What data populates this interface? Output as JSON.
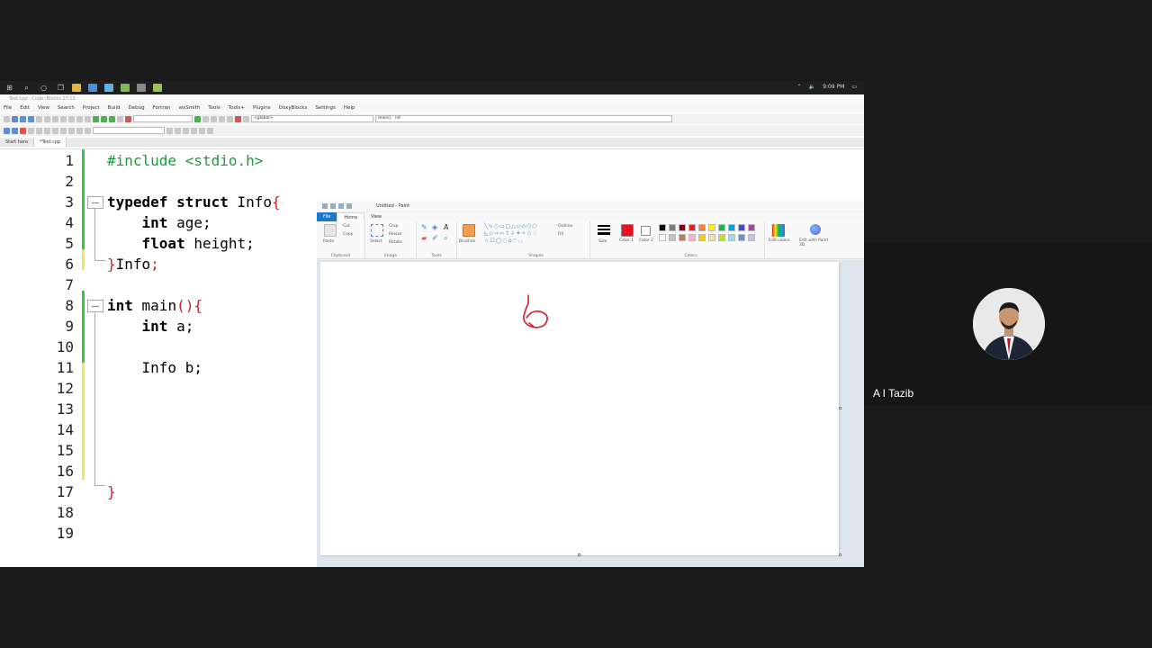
{
  "taskbar": {
    "time": "9:09 PM",
    "icons": [
      "windows-icon",
      "search-icon",
      "cortana-icon",
      "task-view-icon"
    ]
  },
  "codeblocks": {
    "window_title": "Test.cpp - Code::Blocks 17.12",
    "menu": [
      "File",
      "Edit",
      "View",
      "Search",
      "Project",
      "Build",
      "Debug",
      "Fortran",
      "wxSmith",
      "Tools",
      "Tools+",
      "Plugins",
      "DoxyBlocks",
      "Settings",
      "Help"
    ],
    "scope_combo": "<global>",
    "function_combo": "main() : int",
    "tabs": [
      "Start here",
      "*Test.cpp"
    ],
    "line_numbers": [
      "1",
      "2",
      "3",
      "4",
      "5",
      "6",
      "7",
      "8",
      "9",
      "10",
      "11",
      "12",
      "13",
      "14",
      "15",
      "16",
      "17",
      "18",
      "19"
    ],
    "code": {
      "l1_pp": "#include <stdio.h>",
      "l3_kw": "typedef struct",
      "l3_name": " Info",
      "l3_brace": "{",
      "l4_kw": "int",
      "l4_rest": " age;",
      "l5_kw": "float",
      "l5_rest": " height;",
      "l6_brace": "}",
      "l6_name": "Info",
      "l6_semi": ";",
      "l8_kw": "int",
      "l8_name": " main",
      "l8_paren": "(){",
      "l9_kw": "int",
      "l9_rest": " a;",
      "l11_text": "Info b;",
      "l17_brace": "}"
    }
  },
  "paint": {
    "window_title": "Untitled - Paint",
    "tabs": {
      "file": "File",
      "home": "Home",
      "view": "View"
    },
    "groups": {
      "clipboard": "Clipboard",
      "image": "Image",
      "tools": "Tools",
      "shapes": "Shapes",
      "colors": "Colors"
    },
    "buttons": {
      "paste": "Paste",
      "cut": "Cut",
      "copy": "Copy",
      "select": "Select",
      "crop": "Crop",
      "resize": "Resize",
      "rotate": "Rotate",
      "brushes": "Brushes",
      "outline": "Outline",
      "fill": "Fill",
      "size": "Size",
      "color1": "Color 1",
      "color2": "Color 2",
      "edit_colors": "Edit colors",
      "edit_paint3d": "Edit with Paint 3D"
    },
    "color1": "#e81123",
    "color2": "#ffffff",
    "palette": [
      "#000000",
      "#7f7f7f",
      "#880015",
      "#ed1c24",
      "#ff7f27",
      "#fff200",
      "#22b14c",
      "#00a2e8",
      "#3f48cc",
      "#a349a4",
      "#ffffff",
      "#c3c3c3",
      "#b97a57",
      "#ffaec9",
      "#ffc90e",
      "#efe4b0",
      "#b5e61d",
      "#99d9ea",
      "#7092be",
      "#c8bfe7"
    ],
    "drawing_stroke_color": "#d81b2a"
  },
  "participant": {
    "name": "A I Tazib"
  }
}
